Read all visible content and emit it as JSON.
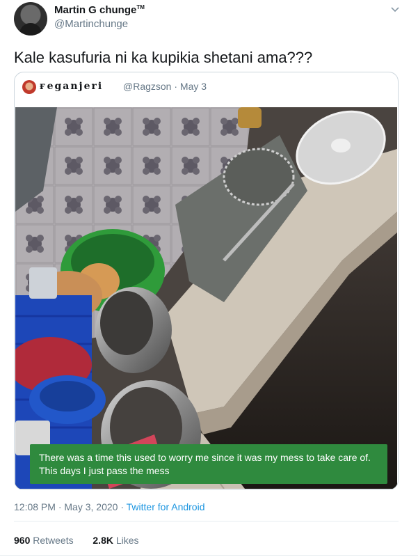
{
  "author": {
    "name": "Martin G chunge",
    "name_mark": "TM",
    "handle": "@Martinchunge"
  },
  "tweet": {
    "text": "Kale kasufuria ni ka kupikia shetani ama???"
  },
  "quoted": {
    "name": "ғеgаnjеri",
    "handle": "@Ragzson",
    "separator": "·",
    "date": "May 3",
    "caption_line1": "There was a time this used to worry me since it was my mess to take care of.",
    "caption_line2": "This days I just pass the mess"
  },
  "meta": {
    "time": "12:08 PM",
    "separator": "·",
    "date": "May 3, 2020",
    "source": "Twitter for Android"
  },
  "stats": {
    "retweets_count": "960",
    "retweets_label": "Retweets",
    "likes_count": "2.8K",
    "likes_label": "Likes"
  },
  "colors": {
    "link": "#1b95e0",
    "secondary_text": "#657786",
    "caption_bg": "#2f8a3e"
  },
  "icons": {
    "menu": "chevron-down-icon"
  }
}
